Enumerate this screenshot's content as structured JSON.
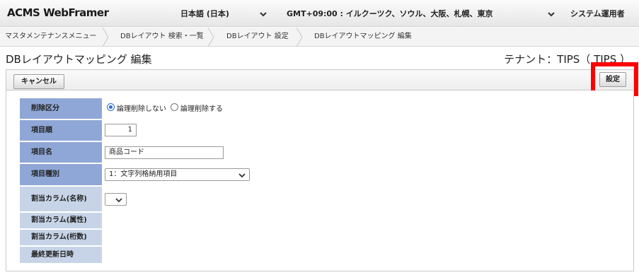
{
  "header": {
    "logo": "ACMS WebFramer",
    "language": "日本語 (日本)",
    "timezone": "GMT+09:00 : イルクーツク、ソウル、大阪、札幌、東京",
    "user": "システム運用者"
  },
  "breadcrumb": [
    "マスタメンテナンスメニュー",
    "DBレイアウト 検索・一覧",
    "DBレイアウト 設定",
    "DBレイアウトマッピング 編集"
  ],
  "page": {
    "title": "DBレイアウトマッピング 編集",
    "tenant": "テナント：TIPS（ TIPS ）"
  },
  "toolbar": {
    "cancel_label": "キャンセル",
    "save_label": "設定"
  },
  "form": {
    "delete_type": {
      "label": "削除区分",
      "options": [
        "論理削除しない",
        "論理削除する"
      ],
      "selected": 0
    },
    "item_order": {
      "label": "項目順",
      "value": "1"
    },
    "item_name": {
      "label": "項目名",
      "value": "商品コード"
    },
    "item_type": {
      "label": "項目種別",
      "value": "1：文字列格納用項目"
    },
    "assign_col_name": {
      "label": "割当カラム(名称)",
      "value": ""
    },
    "assign_col_attr": {
      "label": "割当カラム(属性)"
    },
    "assign_col_digits": {
      "label": "割当カラム(桁数)"
    },
    "last_updated": {
      "label": "最終更新日時"
    }
  },
  "colors": {
    "label_active": "#8fa7d6",
    "label_inactive": "#c7d4e8",
    "highlight": "#ff0000"
  }
}
